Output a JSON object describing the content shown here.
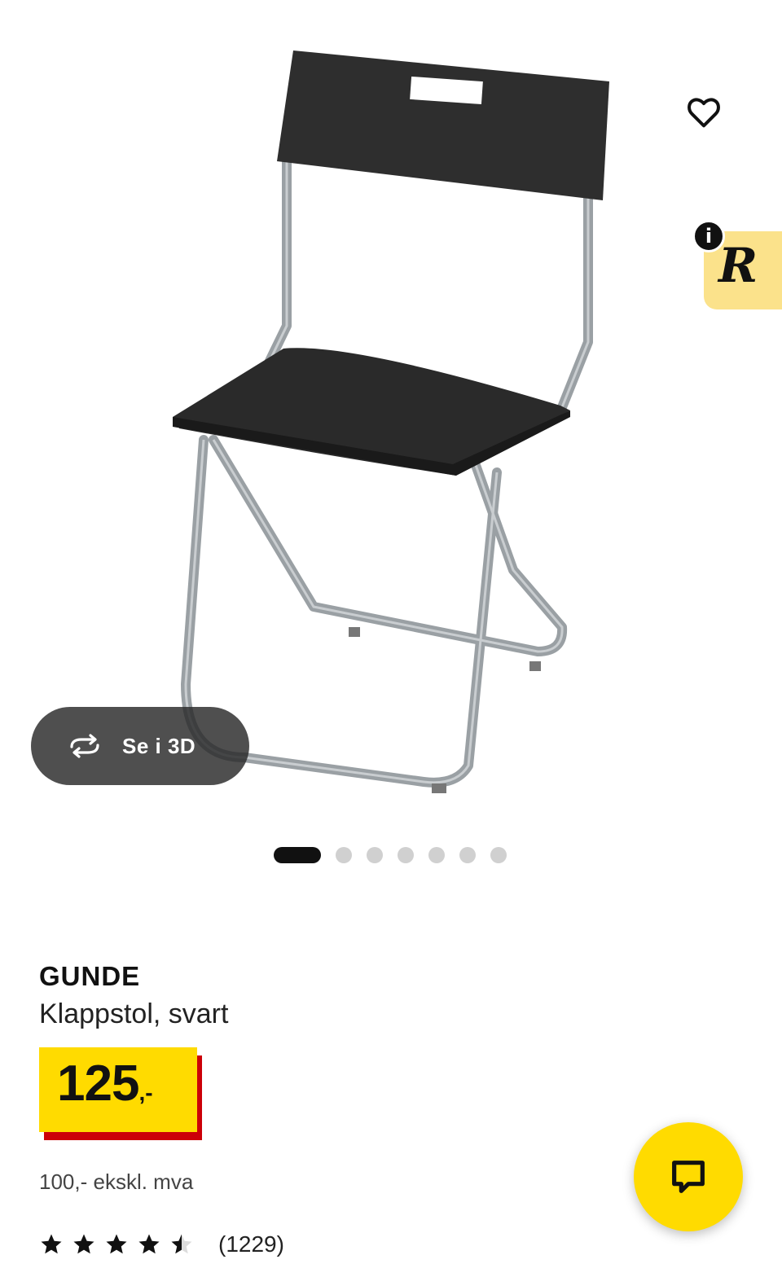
{
  "product": {
    "name": "GUNDE",
    "description": "Klappstol, svart",
    "price_integer": "125",
    "price_suffix": ",-",
    "price_ex_vat": "100,- ekskl. mva",
    "rating_value": 4.5,
    "rating_max": 5,
    "review_count": "(1229)"
  },
  "gallery": {
    "view_3d_label": "Se i 3D",
    "image_count": 7,
    "active_index": 0
  },
  "badges": {
    "info_label": "i",
    "r_label": "R"
  },
  "icons": {
    "favorite": "heart-outline-icon",
    "rotate": "rotate-3d-icon",
    "chat": "chat-bubble-icon",
    "star": "star-icon"
  },
  "colors": {
    "price_yellow": "#ffdb00",
    "price_red": "#cc0008",
    "badge_yellow": "#fbe28b",
    "chat_yellow": "#ffdb00"
  }
}
